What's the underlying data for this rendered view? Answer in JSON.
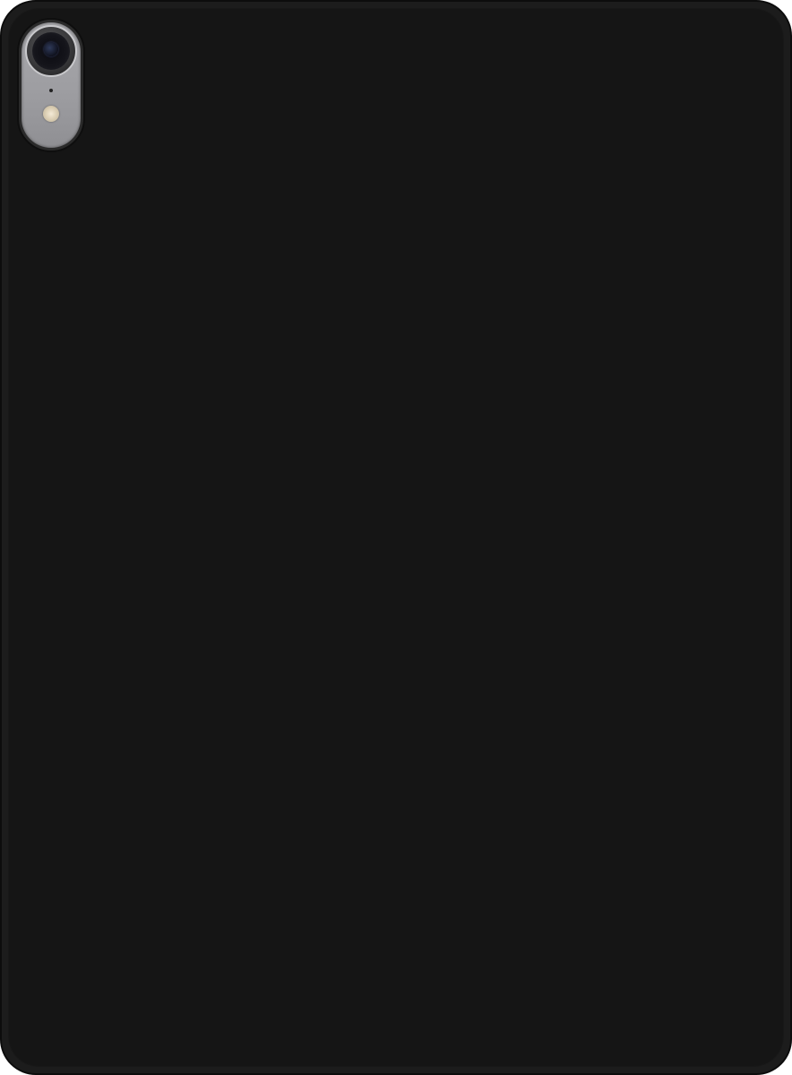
{
  "photo": {
    "subject": "tablet-case-back",
    "colors": {
      "case": "#151515",
      "case_rim": "#1c1c1c",
      "camera_bump": "#a0a0a4",
      "flash": "#e8dcc4"
    }
  }
}
